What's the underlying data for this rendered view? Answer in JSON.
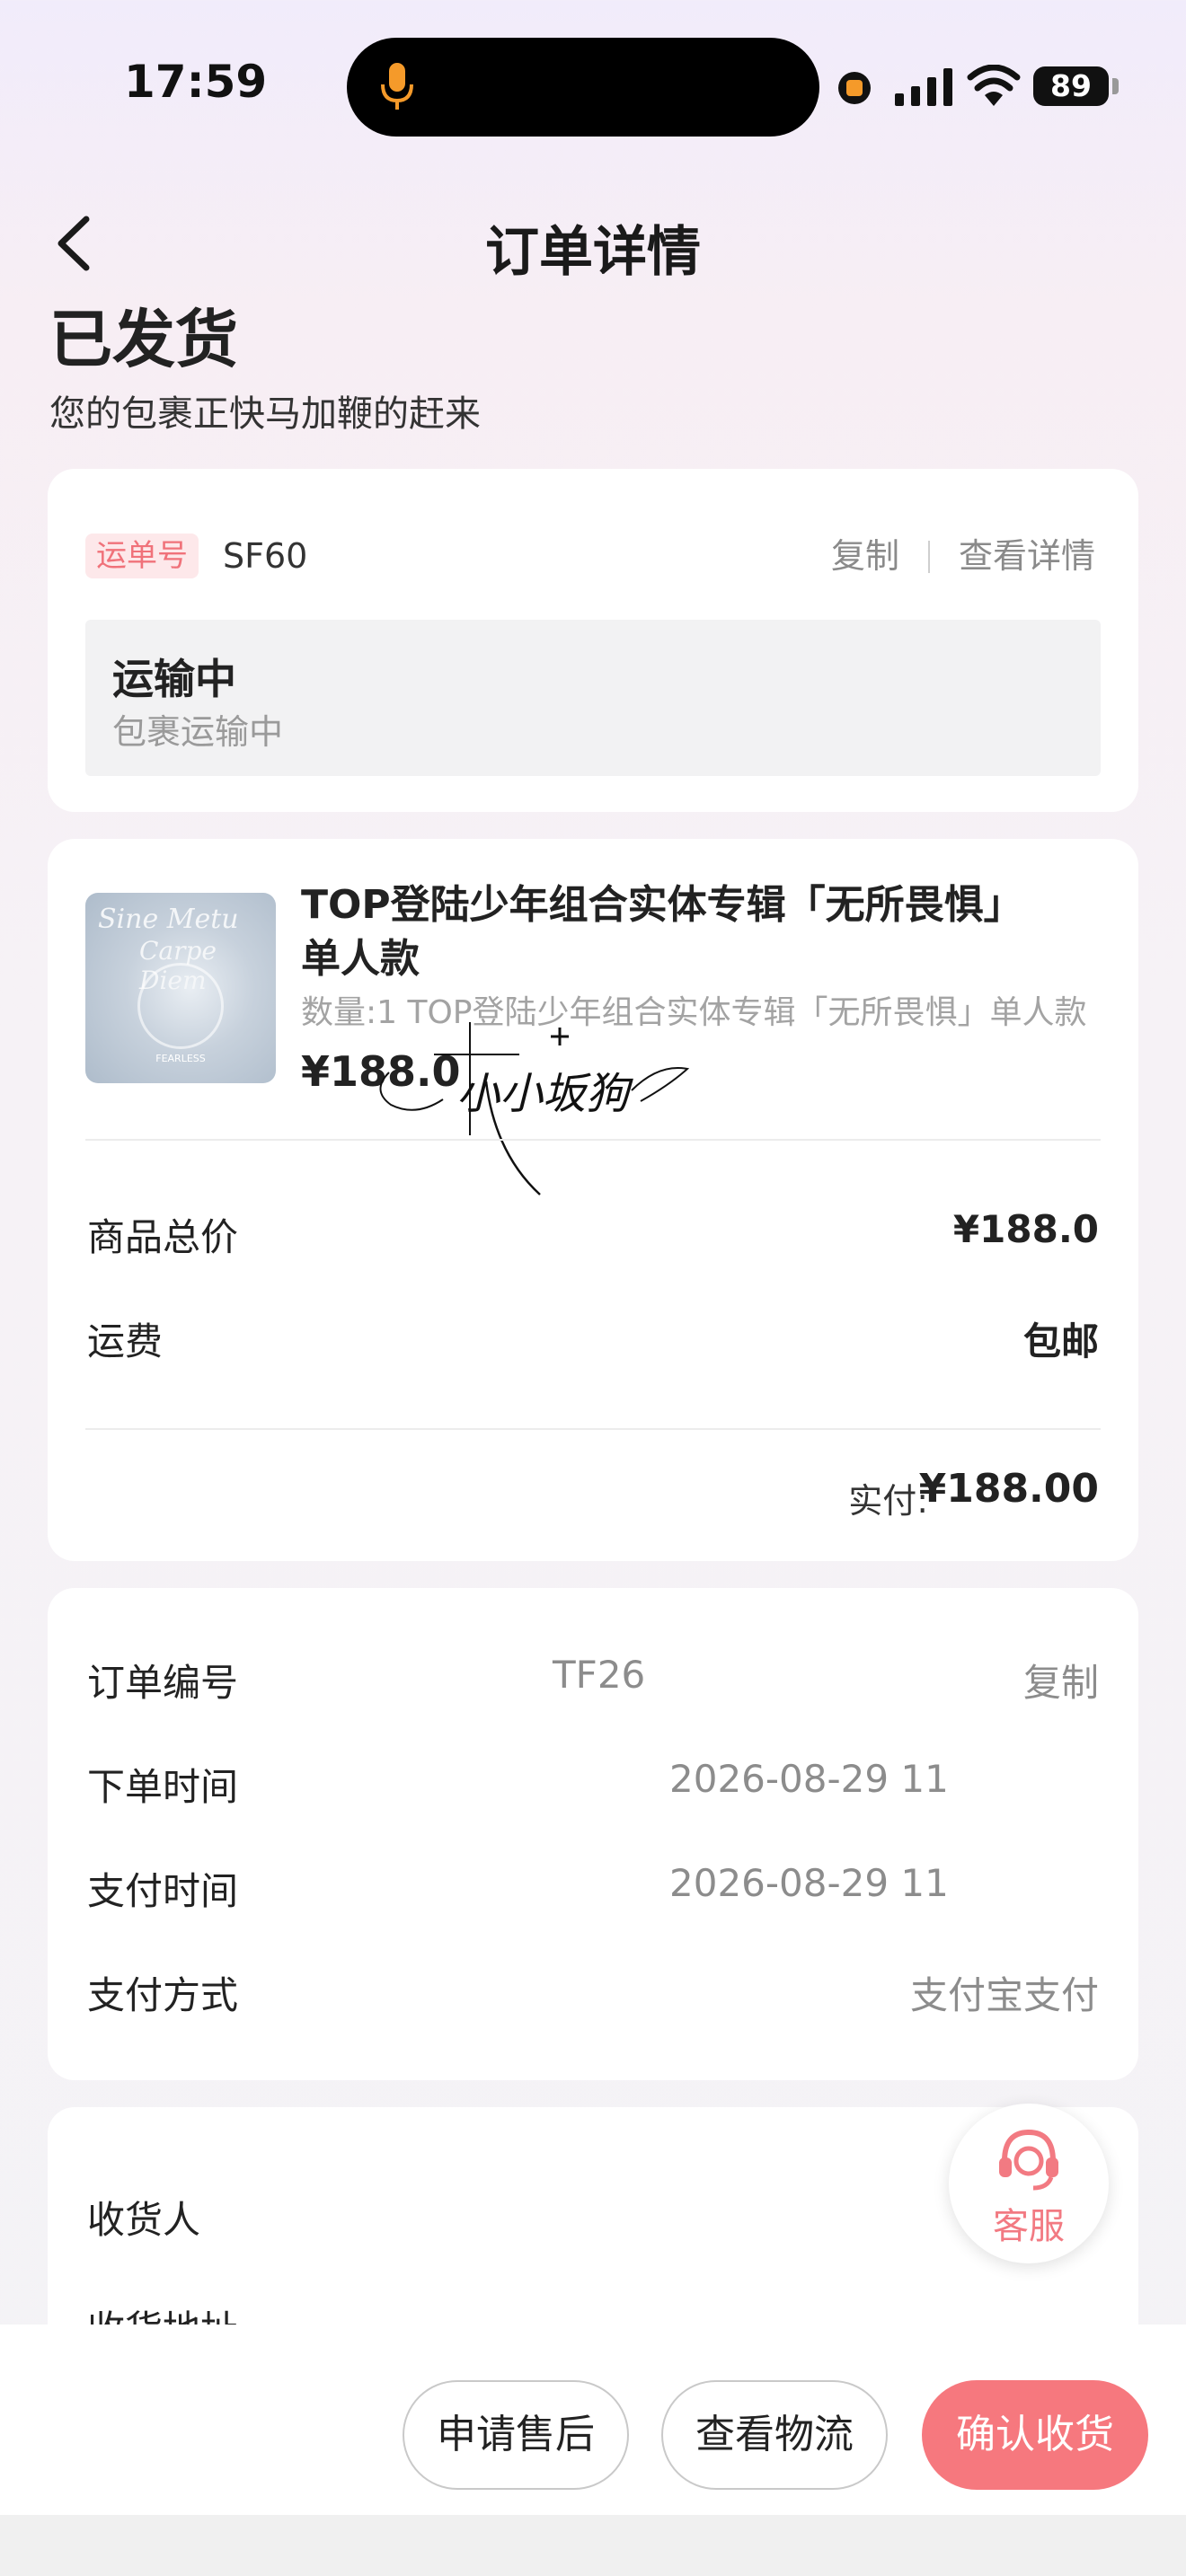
{
  "status_bar": {
    "time": "17:59",
    "battery": "89"
  },
  "header": {
    "title": "订单详情"
  },
  "order_status": {
    "title": "已发货",
    "subtitle": "您的包裹正快马加鞭的赶来"
  },
  "shipping": {
    "tag": "运单号",
    "number": "SF60",
    "copy": "复制",
    "details": "查看详情",
    "transit_title": "运输中",
    "transit_sub": "包裹运输中"
  },
  "product": {
    "image_text_1": "Sine Metu",
    "image_text_2": "Carpe Diem",
    "image_text_3": "FEARLESS",
    "title": "TOP登陆少年组合实体专辑「无所畏惧」单人款",
    "quantity": "数量:1 TOP登陆少年组合实体专辑「无所畏惧」单人款",
    "price": "¥188.0"
  },
  "watermark_text": "小小坂狗",
  "summary": {
    "total_label": "商品总价",
    "total_value": "¥188.0",
    "shipping_label": "运费",
    "shipping_value": "包邮",
    "paid_label": "实付:",
    "paid_value": "¥188.00"
  },
  "order_info": {
    "number_label": "订单编号",
    "number_value": "TF26",
    "number_copy": "复制",
    "order_time_label": "下单时间",
    "order_time_value": "2026-08-29 11",
    "pay_time_label": "支付时间",
    "pay_time_value": "2026-08-29 11",
    "pay_method_label": "支付方式",
    "pay_method_value": "支付宝支付"
  },
  "receiver": {
    "name_label": "收货人",
    "address_label": "收货地址"
  },
  "service": {
    "label": "客服"
  },
  "actions": {
    "after_sale": "申请售后",
    "logistics": "查看物流",
    "confirm": "确认收货"
  },
  "colors": {
    "accent": "#f6787e",
    "tag_bg": "#fde8ea",
    "tag_text": "#f0727a"
  }
}
